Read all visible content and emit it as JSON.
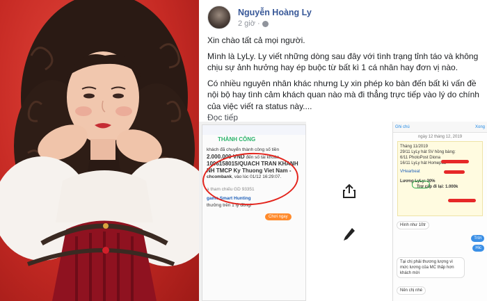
{
  "post": {
    "author": "Nguyễn Hoàng Ly",
    "time": "2 giờ",
    "paragraphs": [
      "Xin chào tất cả mọi người.",
      "Mình là LyLy. Ly viết những dòng sau đây với tình trạng tỉnh táo và không chịu sự ảnh hưởng hay ép buộc từ bất kì 1 cá nhân hay đơn vị nào.",
      "Có nhiều nguyên nhân khác nhưng Ly xin phép ko bàn đến bất kì vấn đề nội bộ hay tình cảm khách quan nào mà đi thẳng trực tiếp vào lý do chính của việc viết ra status này...."
    ],
    "see_more": "Đọc tiếp"
  },
  "screenshot_left": {
    "title": "THÀNH CÔNG",
    "line1": "khách đã chuyển thành công số tiền",
    "amount": "2.000.000 VND",
    "line2": "đến số tài khoản",
    "account": "1096158015/QUACH TRAN KHANH",
    "bank1": "NH TMCP Ky Thuong Viet Nam -",
    "bank2": "chcombank",
    "time_label": ", vào lúc 01/12 16:29:07.",
    "ref": "a tham chiếu GD 93351",
    "game": "game Smart Hunting",
    "game2": "thưởng trên 1 tỷ đồng!",
    "button": "Chơi ngay"
  },
  "screenshot_right": {
    "back": "Ghi chú",
    "done": "Xong",
    "date": "ngày 12 tháng 12, 2019",
    "note_lines": [
      "Tháng 11/2019",
      "29/11 LyLy hát SV hồng bàng:",
      "6/11 PhotoPost Diona",
      "16/11 LyLy hát Homepub",
      "VHearbeat",
      "Lương LyLy: 30%",
      "Trợ cấp đi lại: 1.000k"
    ],
    "messages": [
      "Hình như 10tr",
      "Trời",
      "Hic",
      "Tại chị phải thương lượng vì mức lương của MC thấp hơn khách mời",
      "Nên chị nhé"
    ]
  }
}
